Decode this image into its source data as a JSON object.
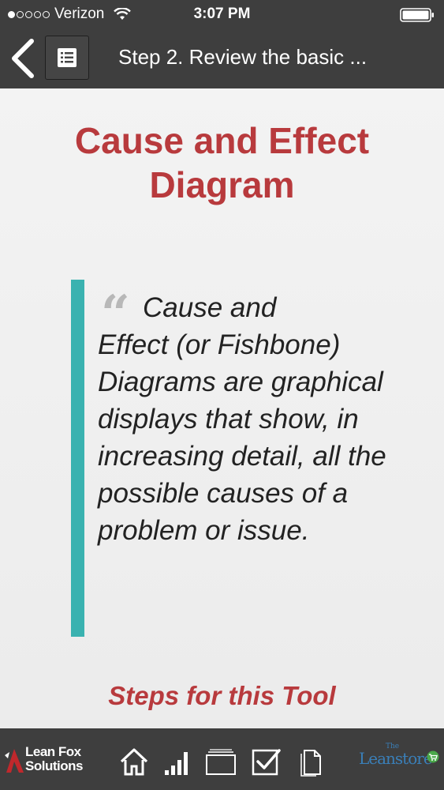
{
  "status_bar": {
    "carrier": "Verizon",
    "time": "3:07 PM",
    "signal_bars_filled": 1,
    "signal_bars_total": 5
  },
  "nav": {
    "title": "Step 2. Review the basic ...",
    "back_icon": "chevron-left-icon",
    "menu_icon": "list-icon"
  },
  "content": {
    "heading_line1": "Cause and Effect",
    "heading_line2": "Diagram",
    "quote_mark": "“",
    "quote_first_line": "Cause and",
    "quote_rest": "Effect (or Fishbone) Diagrams are graphical displays that show, in increasing detail, all the possible causes of a problem or issue.",
    "steps_heading": "Steps for this Tool"
  },
  "bottom_bar": {
    "left_logo_line1": "Lean Fox",
    "left_logo_line2": "Solutions",
    "right_logo_the": "The",
    "right_logo_brand": "Leanstore",
    "icons": [
      "home-icon",
      "bar-chart-icon",
      "folder-icon",
      "checkbox-icon",
      "document-icon"
    ]
  },
  "colors": {
    "header_bg": "#3e3e3e",
    "heading_red": "#b83a3d",
    "accent_teal": "#3ab2b0",
    "body_bg": "#ededed",
    "quote_text": "#222222"
  }
}
